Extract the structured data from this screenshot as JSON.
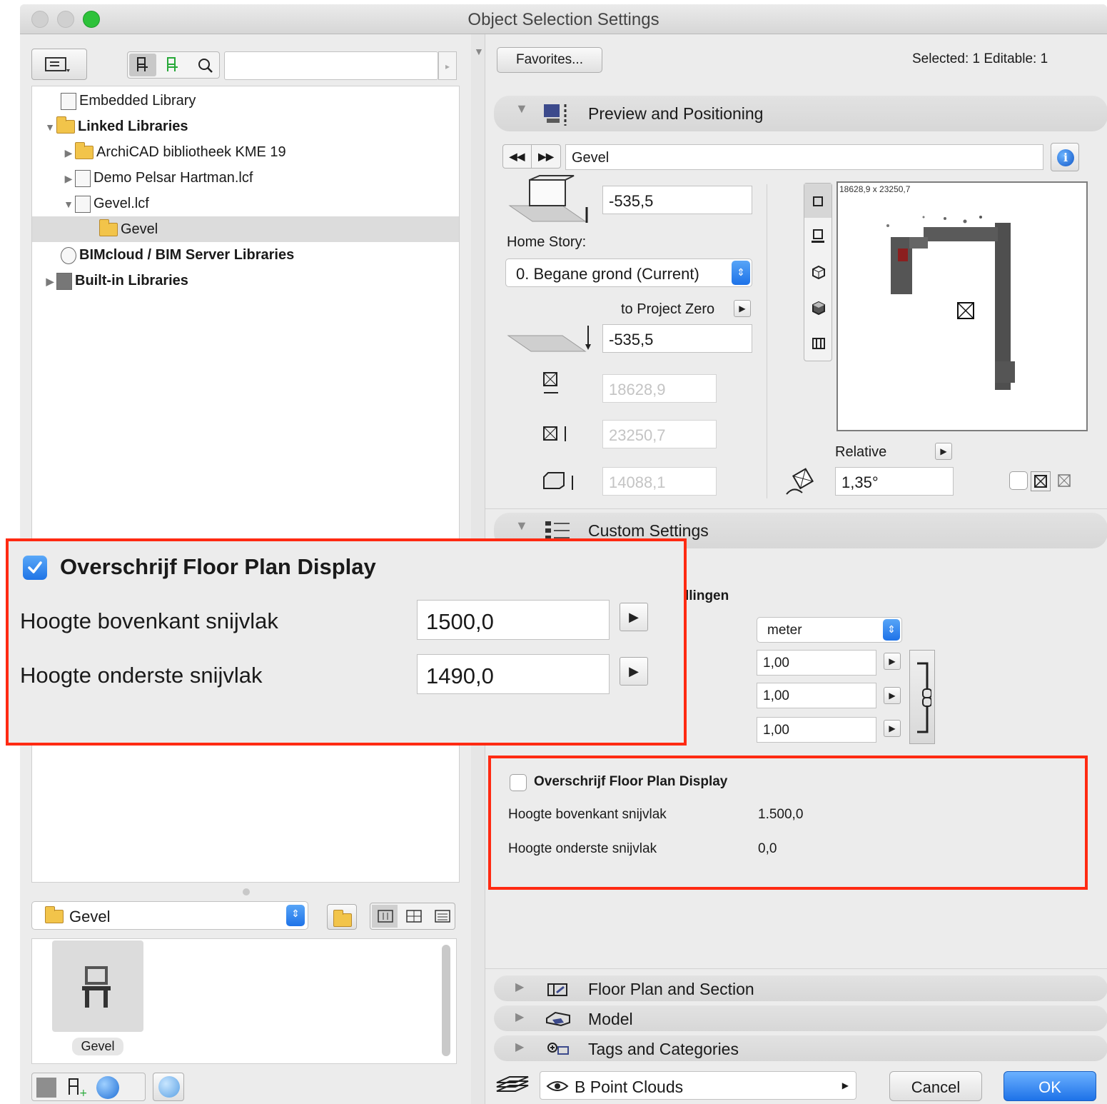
{
  "window": {
    "title": "Object Selection Settings"
  },
  "library": {
    "tree": [
      {
        "label": "Embedded Library",
        "bold": false
      },
      {
        "label": "Linked Libraries",
        "bold": true
      },
      {
        "label": "ArchiCAD bibliotheek KME 19",
        "bold": false
      },
      {
        "label": "Demo Pelsar Hartman.lcf",
        "bold": false
      },
      {
        "label": "Gevel.lcf",
        "bold": false
      },
      {
        "label": "Gevel",
        "bold": false,
        "selected": true
      },
      {
        "label": "BIMcloud / BIM Server Libraries",
        "bold": true
      },
      {
        "label": "Built-in Libraries",
        "bold": true
      }
    ],
    "folder_select": "Gevel",
    "thumbnail_label": "Gevel"
  },
  "header": {
    "favorites_label": "Favorites...",
    "selected_info": "Selected: 1 Editable: 1"
  },
  "preview": {
    "section_title": "Preview and Positioning",
    "object_name": "Gevel",
    "elevation_value": "-535,5",
    "home_story_label": "Home Story:",
    "home_story_value": "0. Begane grond (Current)",
    "to_project_zero_label": "to Project Zero",
    "project_zero_value": "-535,5",
    "width_value": "18628,9",
    "depth_value": "23250,7",
    "height_value": "14088,1",
    "preview_size_label": "18628,9 x 23250,7",
    "relative_label": "Relative",
    "angle_value": "1,35°"
  },
  "custom": {
    "section_title": "Custom Settings",
    "partial_label": "llingen",
    "unit_value": "meter",
    "scale_values": [
      "1,00",
      "1,00",
      "1,00"
    ]
  },
  "zoom_callout": {
    "checkbox_label": "Overschrijf Floor Plan Display",
    "checked": true,
    "rows": [
      {
        "label": "Hoogte bovenkant snijvlak",
        "value": "1500,0"
      },
      {
        "label": "Hoogte onderste snijvlak",
        "value": "1490,0"
      }
    ]
  },
  "original_panel": {
    "checkbox_label": "Overschrijf Floor Plan Display",
    "checked": false,
    "rows": [
      {
        "label": "Hoogte bovenkant snijvlak",
        "value": "1.500,0"
      },
      {
        "label": "Hoogte onderste snijvlak",
        "value": "0,0"
      }
    ]
  },
  "collapsed_sections": [
    "Floor Plan and Section",
    "Model",
    "Tags and Categories"
  ],
  "footer": {
    "layer_value": "B Point Clouds",
    "cancel_label": "Cancel",
    "ok_label": "OK"
  },
  "colors": {
    "accent_blue": "#1d72e8",
    "highlight_red": "#ff2a12",
    "selection_grey": "#dcdcdc"
  }
}
